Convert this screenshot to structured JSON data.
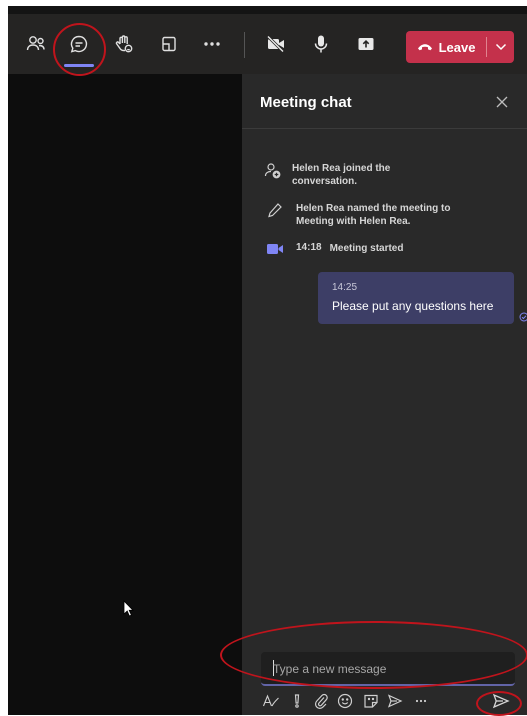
{
  "toolbar": {
    "buttons": [
      {
        "icon": "people-icon"
      },
      {
        "icon": "chat-icon",
        "active": true
      },
      {
        "icon": "raise-hand-icon"
      },
      {
        "icon": "share-tray-icon"
      },
      {
        "icon": "more-icon"
      },
      {
        "icon": "camera-off-icon"
      },
      {
        "icon": "microphone-icon"
      },
      {
        "icon": "share-screen-icon"
      }
    ],
    "leave_label": "Leave"
  },
  "chat": {
    "title": "Meeting chat",
    "events": [
      {
        "icon": "participant-joined-icon",
        "text": "Helen Rea joined the conversation."
      },
      {
        "icon": "pencil-icon",
        "text": "Helen Rea named the meeting to Meeting with Helen Rea."
      },
      {
        "icon": "video-camera-icon",
        "time": "14:18",
        "text": "Meeting started"
      }
    ],
    "message": {
      "time": "14:25",
      "text": "Please put any questions here"
    },
    "input_placeholder": "Type a new message"
  },
  "colors": {
    "accent": "#6264a7",
    "leave": "#c4314b",
    "annotation": "#c0141c",
    "bubble": "#3d3e66"
  }
}
